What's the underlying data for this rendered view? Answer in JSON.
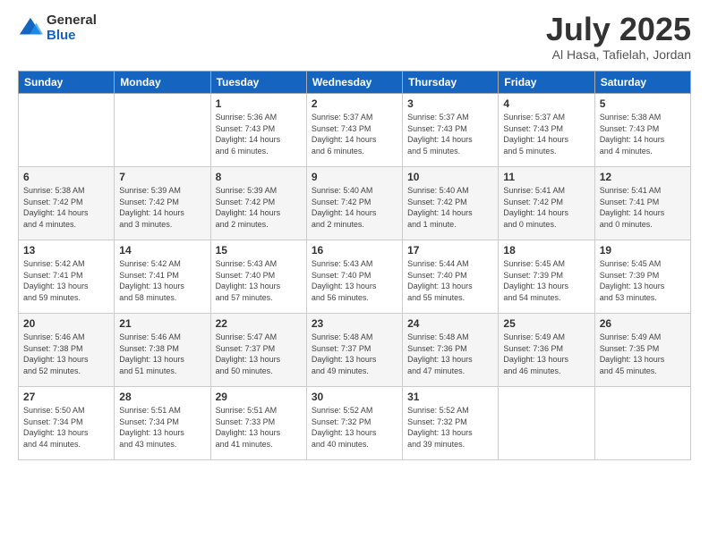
{
  "logo": {
    "general": "General",
    "blue": "Blue"
  },
  "title": "July 2025",
  "location": "Al Hasa, Tafielah, Jordan",
  "weekdays": [
    "Sunday",
    "Monday",
    "Tuesday",
    "Wednesday",
    "Thursday",
    "Friday",
    "Saturday"
  ],
  "weeks": [
    [
      {
        "day": "",
        "info": ""
      },
      {
        "day": "",
        "info": ""
      },
      {
        "day": "1",
        "info": "Sunrise: 5:36 AM\nSunset: 7:43 PM\nDaylight: 14 hours\nand 6 minutes."
      },
      {
        "day": "2",
        "info": "Sunrise: 5:37 AM\nSunset: 7:43 PM\nDaylight: 14 hours\nand 6 minutes."
      },
      {
        "day": "3",
        "info": "Sunrise: 5:37 AM\nSunset: 7:43 PM\nDaylight: 14 hours\nand 5 minutes."
      },
      {
        "day": "4",
        "info": "Sunrise: 5:37 AM\nSunset: 7:43 PM\nDaylight: 14 hours\nand 5 minutes."
      },
      {
        "day": "5",
        "info": "Sunrise: 5:38 AM\nSunset: 7:43 PM\nDaylight: 14 hours\nand 4 minutes."
      }
    ],
    [
      {
        "day": "6",
        "info": "Sunrise: 5:38 AM\nSunset: 7:42 PM\nDaylight: 14 hours\nand 4 minutes."
      },
      {
        "day": "7",
        "info": "Sunrise: 5:39 AM\nSunset: 7:42 PM\nDaylight: 14 hours\nand 3 minutes."
      },
      {
        "day": "8",
        "info": "Sunrise: 5:39 AM\nSunset: 7:42 PM\nDaylight: 14 hours\nand 2 minutes."
      },
      {
        "day": "9",
        "info": "Sunrise: 5:40 AM\nSunset: 7:42 PM\nDaylight: 14 hours\nand 2 minutes."
      },
      {
        "day": "10",
        "info": "Sunrise: 5:40 AM\nSunset: 7:42 PM\nDaylight: 14 hours\nand 1 minute."
      },
      {
        "day": "11",
        "info": "Sunrise: 5:41 AM\nSunset: 7:42 PM\nDaylight: 14 hours\nand 0 minutes."
      },
      {
        "day": "12",
        "info": "Sunrise: 5:41 AM\nSunset: 7:41 PM\nDaylight: 14 hours\nand 0 minutes."
      }
    ],
    [
      {
        "day": "13",
        "info": "Sunrise: 5:42 AM\nSunset: 7:41 PM\nDaylight: 13 hours\nand 59 minutes."
      },
      {
        "day": "14",
        "info": "Sunrise: 5:42 AM\nSunset: 7:41 PM\nDaylight: 13 hours\nand 58 minutes."
      },
      {
        "day": "15",
        "info": "Sunrise: 5:43 AM\nSunset: 7:40 PM\nDaylight: 13 hours\nand 57 minutes."
      },
      {
        "day": "16",
        "info": "Sunrise: 5:43 AM\nSunset: 7:40 PM\nDaylight: 13 hours\nand 56 minutes."
      },
      {
        "day": "17",
        "info": "Sunrise: 5:44 AM\nSunset: 7:40 PM\nDaylight: 13 hours\nand 55 minutes."
      },
      {
        "day": "18",
        "info": "Sunrise: 5:45 AM\nSunset: 7:39 PM\nDaylight: 13 hours\nand 54 minutes."
      },
      {
        "day": "19",
        "info": "Sunrise: 5:45 AM\nSunset: 7:39 PM\nDaylight: 13 hours\nand 53 minutes."
      }
    ],
    [
      {
        "day": "20",
        "info": "Sunrise: 5:46 AM\nSunset: 7:38 PM\nDaylight: 13 hours\nand 52 minutes."
      },
      {
        "day": "21",
        "info": "Sunrise: 5:46 AM\nSunset: 7:38 PM\nDaylight: 13 hours\nand 51 minutes."
      },
      {
        "day": "22",
        "info": "Sunrise: 5:47 AM\nSunset: 7:37 PM\nDaylight: 13 hours\nand 50 minutes."
      },
      {
        "day": "23",
        "info": "Sunrise: 5:48 AM\nSunset: 7:37 PM\nDaylight: 13 hours\nand 49 minutes."
      },
      {
        "day": "24",
        "info": "Sunrise: 5:48 AM\nSunset: 7:36 PM\nDaylight: 13 hours\nand 47 minutes."
      },
      {
        "day": "25",
        "info": "Sunrise: 5:49 AM\nSunset: 7:36 PM\nDaylight: 13 hours\nand 46 minutes."
      },
      {
        "day": "26",
        "info": "Sunrise: 5:49 AM\nSunset: 7:35 PM\nDaylight: 13 hours\nand 45 minutes."
      }
    ],
    [
      {
        "day": "27",
        "info": "Sunrise: 5:50 AM\nSunset: 7:34 PM\nDaylight: 13 hours\nand 44 minutes."
      },
      {
        "day": "28",
        "info": "Sunrise: 5:51 AM\nSunset: 7:34 PM\nDaylight: 13 hours\nand 43 minutes."
      },
      {
        "day": "29",
        "info": "Sunrise: 5:51 AM\nSunset: 7:33 PM\nDaylight: 13 hours\nand 41 minutes."
      },
      {
        "day": "30",
        "info": "Sunrise: 5:52 AM\nSunset: 7:32 PM\nDaylight: 13 hours\nand 40 minutes."
      },
      {
        "day": "31",
        "info": "Sunrise: 5:52 AM\nSunset: 7:32 PM\nDaylight: 13 hours\nand 39 minutes."
      },
      {
        "day": "",
        "info": ""
      },
      {
        "day": "",
        "info": ""
      }
    ]
  ]
}
